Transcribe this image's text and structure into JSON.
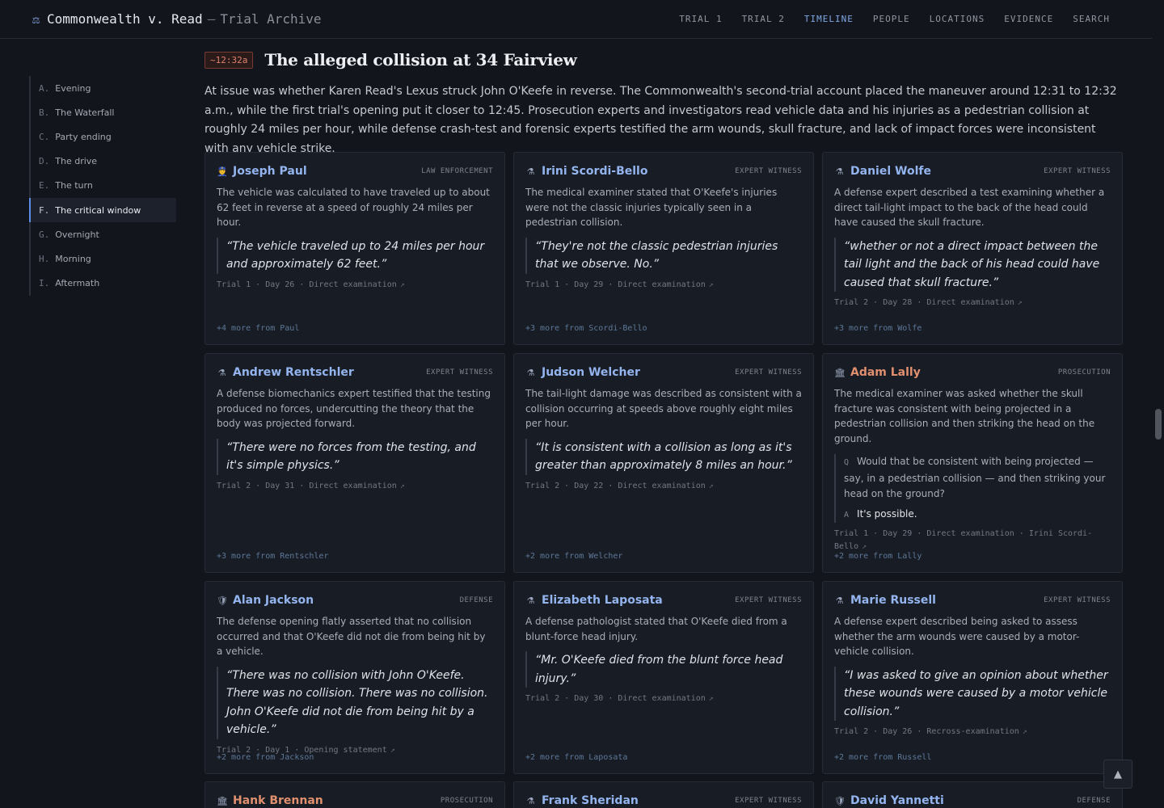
{
  "header": {
    "title": "Commonwealth v. Read",
    "separator": "—",
    "subtitle": "Trial Archive",
    "icon": "scales-icon",
    "nav": [
      {
        "label": "TRIAL 1",
        "active": false
      },
      {
        "label": "TRIAL 2",
        "active": false
      },
      {
        "label": "TIMELINE",
        "active": true
      },
      {
        "label": "PEOPLE",
        "active": false
      },
      {
        "label": "LOCATIONS",
        "active": false
      },
      {
        "label": "EVIDENCE",
        "active": false
      },
      {
        "label": "SEARCH",
        "active": false
      }
    ]
  },
  "sidebar": {
    "items": [
      {
        "letter": "A.",
        "label": "Evening"
      },
      {
        "letter": "B.",
        "label": "The Waterfall"
      },
      {
        "letter": "C.",
        "label": "Party ending"
      },
      {
        "letter": "D.",
        "label": "The drive"
      },
      {
        "letter": "E.",
        "label": "The turn"
      },
      {
        "letter": "F.",
        "label": "The critical window",
        "active": true
      },
      {
        "letter": "G.",
        "label": "Overnight"
      },
      {
        "letter": "H.",
        "label": "Morning"
      },
      {
        "letter": "I.",
        "label": "Aftermath"
      }
    ]
  },
  "section": {
    "time": "~12:32a",
    "title": "The alleged collision at 34 Fairview",
    "intro": "At issue was whether Karen Read's Lexus struck John O'Keefe in reverse. The Commonwealth's second-trial account placed the maneuver around 12:31 to 12:32 a.m., while the first trial's opening put it closer to 12:45. Prosecution experts and investigators read vehicle data and his injuries as a pedestrian collision at roughly 24 miles per hour, while defense crash-test and forensic experts testified the arm wounds, skull fracture, and lack of impact forces were inconsistent with any vehicle strike."
  },
  "cards": [
    {
      "name": "Joseph Paul",
      "role": "LAW ENFORCEMENT",
      "icon": "officer-icon",
      "kind": "law",
      "summary": "The vehicle was calculated to have traveled up to about 62 feet in reverse at a speed of roughly 24 miles per hour.",
      "quote": "The vehicle traveled up to 24 miles per hour and approximately 62 feet.",
      "cite": "Trial 1 · Day 26 · Direct examination",
      "more": "+4 more from Paul"
    },
    {
      "name": "Irini Scordi-Bello",
      "role": "EXPERT WITNESS",
      "icon": "microscope-icon",
      "kind": "expert",
      "summary": "The medical examiner stated that O'Keefe's injuries were not the classic injuries typically seen in a pedestrian collision.",
      "quote": "They're not the classic pedestrian injuries that we observe. No.",
      "cite": "Trial 1 · Day 29 · Direct examination",
      "more": "+3 more from Scordi-Bello"
    },
    {
      "name": "Daniel Wolfe",
      "role": "EXPERT WITNESS",
      "icon": "microscope-icon",
      "kind": "expert",
      "summary": "A defense expert described a test examining whether a direct tail-light impact to the back of the head could have caused the skull fracture.",
      "quote": "whether or not a direct impact between the tail light and the back of his head could have caused that skull fracture.",
      "cite": "Trial 2 · Day 28 · Direct examination",
      "more": "+3 more from Wolfe"
    },
    {
      "name": "Andrew Rentschler",
      "role": "EXPERT WITNESS",
      "icon": "microscope-icon",
      "kind": "expert",
      "summary": "A defense biomechanics expert testified that the testing produced no forces, undercutting the theory that the body was projected forward.",
      "quote": "There were no forces from the testing, and it's simple physics.",
      "cite": "Trial 2 · Day 31 · Direct examination",
      "more": "+3 more from Rentschler"
    },
    {
      "name": "Judson Welcher",
      "role": "EXPERT WITNESS",
      "icon": "microscope-icon",
      "kind": "expert",
      "summary": "The tail-light damage was described as consistent with a collision occurring at speeds above roughly eight miles per hour.",
      "quote": "It is consistent with a collision as long as it's greater than approximately 8 miles an hour.",
      "cite": "Trial 2 · Day 22 · Direct examination",
      "more": "+2 more from Welcher"
    },
    {
      "name": "Adam Lally",
      "role": "PROSECUTION",
      "icon": "courthouse-icon",
      "kind": "pros",
      "summary": "The medical examiner was asked whether the skull fracture was consistent with being projected in a pedestrian collision and then striking the head on the ground.",
      "qa_q_label": "Q",
      "qa_q": "Would that be consistent with being projected — say, in a pedestrian collision — and then striking your head on the ground?",
      "qa_a_label": "A",
      "qa_a": "It's possible.",
      "cite": "Trial 1 · Day 29 · Direct examination · Irini Scordi-Bello",
      "more": "+2 more from Lally"
    },
    {
      "name": "Alan Jackson",
      "role": "DEFENSE",
      "icon": "shield-icon",
      "kind": "defense",
      "summary": "The defense opening flatly asserted that no collision occurred and that O'Keefe did not die from being hit by a vehicle.",
      "quote": "There was no collision with John O'Keefe. There was no collision. There was no collision. John O'Keefe did not die from being hit by a vehicle.",
      "cite": "Trial 2 · Day 1 · Opening statement",
      "more": "+2 more from Jackson"
    },
    {
      "name": "Elizabeth Laposata",
      "role": "EXPERT WITNESS",
      "icon": "microscope-icon",
      "kind": "expert",
      "summary": "A defense pathologist stated that O'Keefe died from a blunt-force head injury.",
      "quote": "Mr. O'Keefe died from the blunt force head injury.",
      "cite": "Trial 2 · Day 30 · Direct examination",
      "more": "+2 more from Laposata"
    },
    {
      "name": "Marie Russell",
      "role": "EXPERT WITNESS",
      "icon": "microscope-icon",
      "kind": "expert",
      "summary": "A defense expert described being asked to assess whether the arm wounds were caused by a motor-vehicle collision.",
      "quote": "I was asked to give an opinion about whether these wounds were caused by a motor vehicle collision.",
      "cite": "Trial 2 · Day 26 · Recross-examination",
      "more": "+2 more from Russell"
    },
    {
      "name": "Hank Brennan",
      "role": "PROSECUTION",
      "icon": "courthouse-icon",
      "kind": "pros"
    },
    {
      "name": "Frank Sheridan",
      "role": "EXPERT WITNESS",
      "icon": "microscope-icon",
      "kind": "expert"
    },
    {
      "name": "David Yannetti",
      "role": "DEFENSE",
      "icon": "shield-icon",
      "kind": "defense"
    }
  ],
  "controls": {
    "to_top": "▲"
  }
}
